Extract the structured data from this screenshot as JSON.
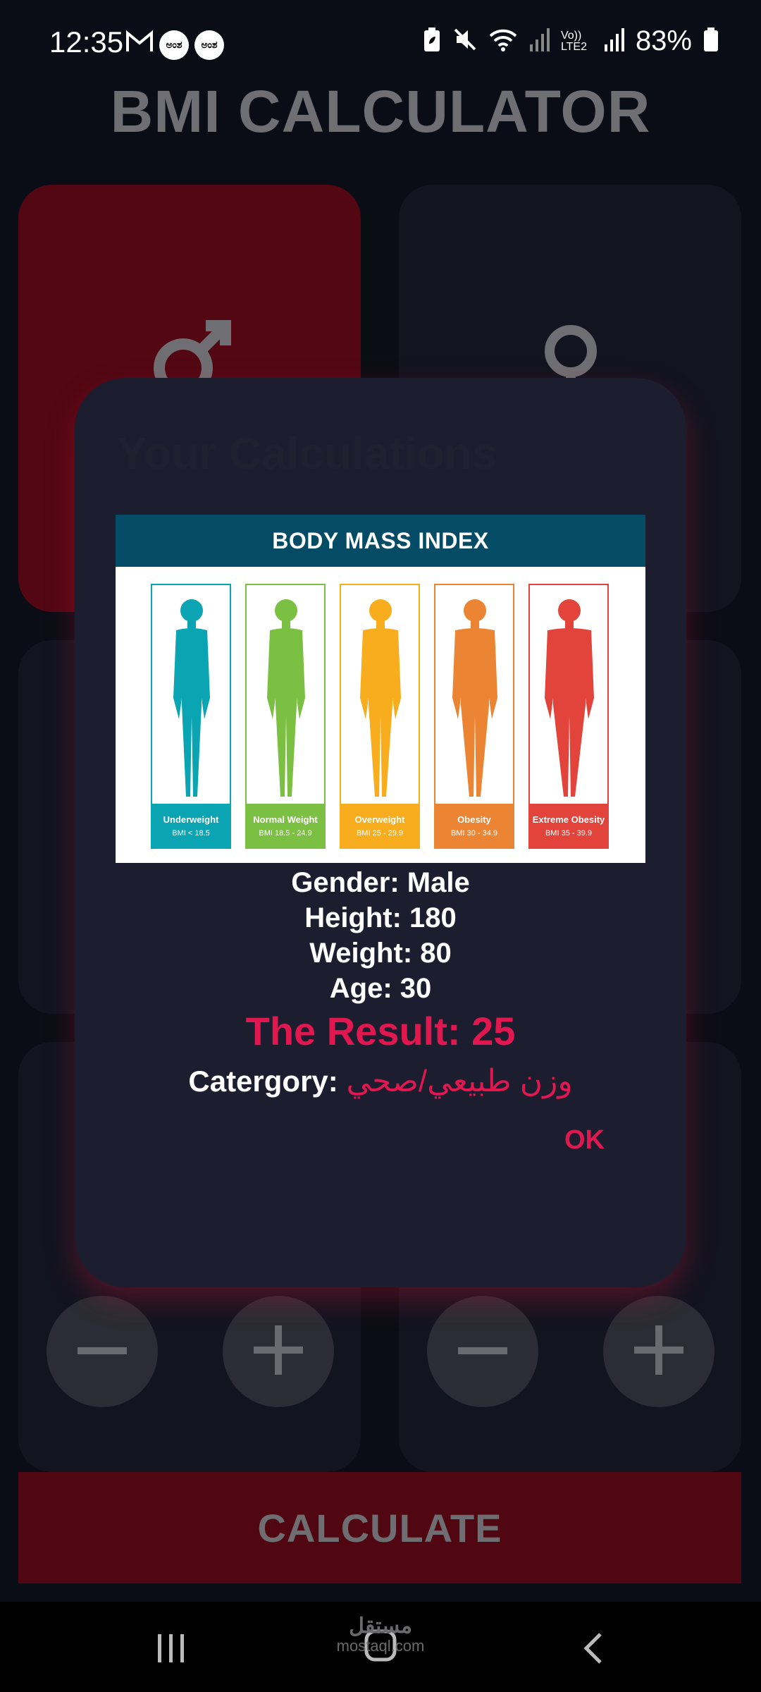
{
  "status_bar": {
    "time": "12:35",
    "left_icons": [
      "gmail-icon",
      "notification-badge-icon",
      "notification-badge-icon"
    ],
    "badge_text": "ಅಂಶ",
    "right_icons": [
      "battery-saver-icon",
      "mute-icon",
      "wifi-icon",
      "signal-icon",
      "volte-icon",
      "signal-icon"
    ],
    "volte_text": "Vo)) LTE2",
    "battery": "83%"
  },
  "app": {
    "title": "BMI CALCULATOR",
    "gender_icons": [
      "male-icon",
      "female-icon"
    ],
    "stepper_icons": [
      "minus-icon",
      "plus-icon",
      "minus-icon",
      "plus-icon"
    ],
    "calculate_label": "CALCULATE",
    "accent": "#e1174f"
  },
  "dialog": {
    "title": "Your Calculations",
    "chart": {
      "title": "BODY MASS INDEX",
      "categories": [
        {
          "name": "Underweight",
          "range": "BMI < 18.5",
          "color": "#0aa4b2"
        },
        {
          "name": "Normal Weight",
          "range": "BMI 18.5 - 24.9",
          "color": "#7bc043"
        },
        {
          "name": "Overweight",
          "range": "BMI 25 - 29.9",
          "color": "#f7ad1e"
        },
        {
          "name": "Obesity",
          "range": "BMI 30 - 34.9",
          "color": "#ec8533"
        },
        {
          "name": "Extreme Obesity",
          "range": "BMI 35 - 39.9",
          "color": "#e2433a"
        }
      ]
    },
    "gender": "Gender: Male",
    "height": "Height: 180",
    "weight": "Weight: 80",
    "age": "Age: 30",
    "result": "The Result: 25",
    "category_label": "Catergory: ",
    "category_value": "وزن طبيعي/صحي",
    "ok_label": "OK"
  },
  "nav_bar": {
    "icons": [
      "recents-icon",
      "home-icon",
      "back-icon"
    ]
  },
  "watermark": {
    "arabic": "مستقل",
    "latin": "mostaql.com"
  }
}
